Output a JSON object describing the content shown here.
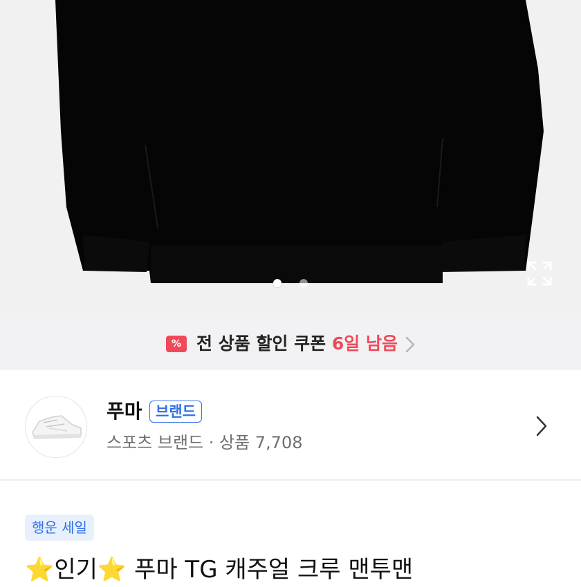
{
  "hero": {
    "image": "black crew sweatshirt product photo",
    "expand_icon": "expand-icon",
    "carousel": {
      "total": 2,
      "active": 1
    }
  },
  "coupon": {
    "icon": "coupon-icon",
    "icon_glyph": "%",
    "text": "전 상품 할인 쿠폰",
    "days_left": "6일 남음",
    "chevron": "chevron-right-icon",
    "accent": "#f04a5a"
  },
  "brand": {
    "logo": "sneaker-thumbnail",
    "name": "푸마",
    "badge": "브랜드",
    "subtitle": "스포츠 브랜드 · 상품 7,708",
    "accent": "#2f6fe8"
  },
  "product": {
    "sale_badge": "행운 세일",
    "star_glyph": "⭐",
    "title_word": "인기",
    "title_name": " 푸마 TG 캐주얼 크루 맨투맨"
  }
}
